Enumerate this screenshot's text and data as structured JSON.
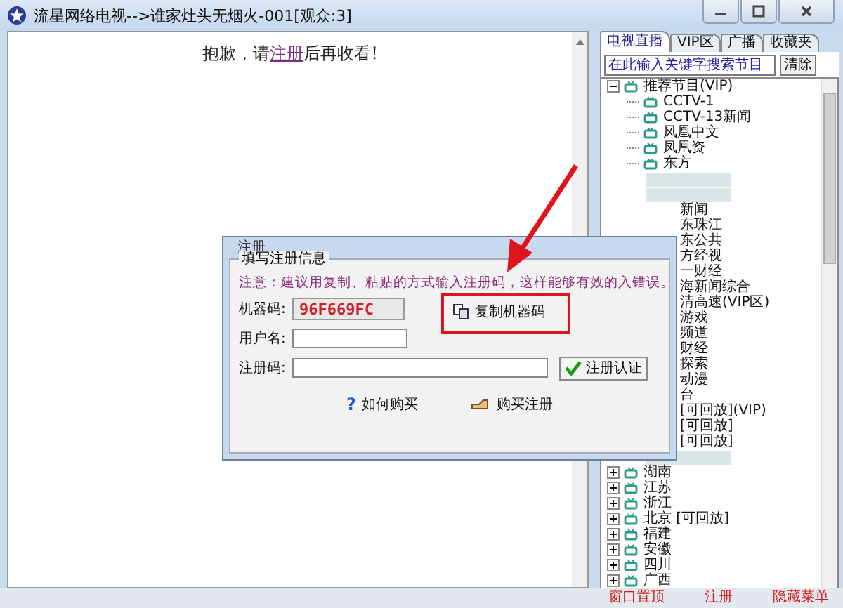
{
  "window": {
    "title": "流星网络电视-->谁家灶头无烟火-001[观众:3]"
  },
  "notice": {
    "before": "抱歉，请",
    "link": "注册",
    "after": "后再收看!"
  },
  "tabs": [
    {
      "label": "电视直播",
      "selected": true
    },
    {
      "label": "VIP区",
      "selected": false
    },
    {
      "label": "广播",
      "selected": false
    },
    {
      "label": "收藏夹",
      "selected": false
    }
  ],
  "search": {
    "value": "在此输入关键字搜索节目",
    "button": "清除"
  },
  "tree": [
    {
      "kind": "node",
      "label": "推荐节目(VIP)",
      "expanded": true,
      "children": [
        {
          "kind": "node",
          "label": "CCTV-1"
        },
        {
          "kind": "node",
          "label": "CCTV-13新闻"
        },
        {
          "kind": "node",
          "label": "凤凰中文"
        },
        {
          "kind": "node",
          "label": "凤凰资"
        },
        {
          "kind": "node",
          "label": "东方"
        },
        {
          "kind": "blurred"
        },
        {
          "kind": "blurred"
        },
        {
          "kind": "fragment",
          "label": "新闻"
        },
        {
          "kind": "fragment",
          "label": "东珠江"
        },
        {
          "kind": "fragment",
          "label": "东公共"
        },
        {
          "kind": "fragment",
          "label": "方经视"
        },
        {
          "kind": "fragment",
          "label": "一财经"
        },
        {
          "kind": "fragment",
          "label": "海新闻综合"
        },
        {
          "kind": "fragment",
          "label": "清高速(VIP区)"
        },
        {
          "kind": "fragment",
          "label": "游戏"
        },
        {
          "kind": "fragment",
          "label": "频道"
        },
        {
          "kind": "fragment",
          "label": "财经"
        },
        {
          "kind": "fragment",
          "label": "探索"
        },
        {
          "kind": "fragment",
          "label": "动漫"
        },
        {
          "kind": "fragment",
          "label": "台"
        },
        {
          "kind": "fragment",
          "label": "[可回放](VIP)"
        },
        {
          "kind": "fragment",
          "label": "[可回放]"
        },
        {
          "kind": "fragment",
          "label": "[可回放]"
        },
        {
          "kind": "blurred"
        }
      ]
    },
    {
      "kind": "node",
      "label": "湖南",
      "expanded": false
    },
    {
      "kind": "node",
      "label": "江苏",
      "expanded": false
    },
    {
      "kind": "node",
      "label": "浙江",
      "expanded": false
    },
    {
      "kind": "node",
      "label": "北京  [可回放]",
      "expanded": false
    },
    {
      "kind": "node",
      "label": "福建",
      "expanded": false
    },
    {
      "kind": "node",
      "label": "安徽",
      "expanded": false
    },
    {
      "kind": "node",
      "label": "四川",
      "expanded": false
    },
    {
      "kind": "node",
      "label": "广西",
      "expanded": false
    }
  ],
  "bottom_links": [
    "窗口置顶",
    "注册",
    "隐藏菜单"
  ],
  "dialog": {
    "title": "注册",
    "group": "填写注册信息",
    "note_before": "注意：建议用复制、粘贴的方式输入注册码，这样能够有效的",
    "note_after": "入错误。",
    "machine_label": "机器码:",
    "machine_code": "96F669FC",
    "copy_button": "复制机器码",
    "user_label": "用户名:",
    "code_label": "注册码:",
    "verify_button": "注册认证",
    "help_mark": "?",
    "how_to_buy": "如何购买",
    "buy": "购买注册"
  }
}
